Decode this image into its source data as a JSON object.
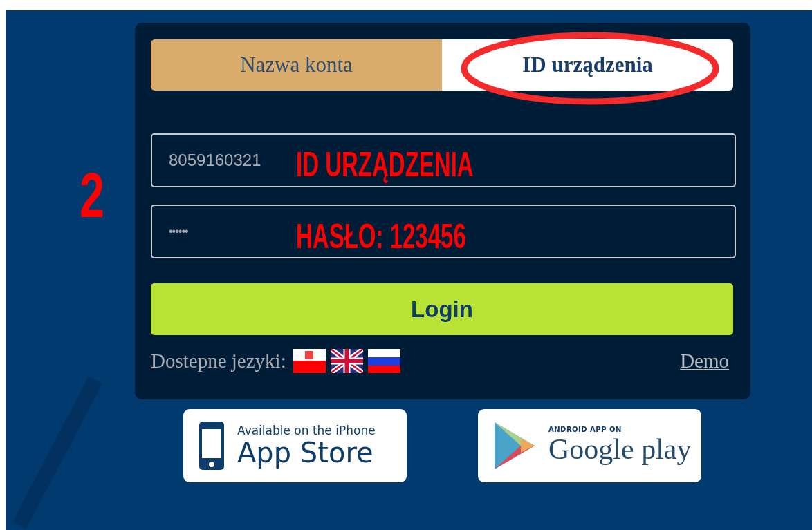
{
  "annotations": {
    "step": "2",
    "device_id_note": "ID URZĄDZENIA",
    "password_note": "HASŁO: 123456"
  },
  "tabs": [
    {
      "label": "Nazwa konta",
      "selected": false,
      "circled": false
    },
    {
      "label": "ID urządzenia",
      "selected": true,
      "circled": true
    }
  ],
  "fields": [
    {
      "kind": "text",
      "value": "8059160321"
    },
    {
      "kind": "password",
      "value": "••••••"
    }
  ],
  "login_button": "Login",
  "footer": {
    "languages_label": "Dostepne jezyki:",
    "languages": [
      {
        "kind": "pl"
      },
      {
        "kind": "gb"
      },
      {
        "kind": "ru"
      }
    ],
    "demo_link": "Demo"
  },
  "badges": [
    {
      "kind": "appstore",
      "small": "Available on the iPhone",
      "large": "App Store"
    },
    {
      "kind": "googleplay",
      "small": "ANDROID APP ON",
      "large": "Google play"
    }
  ]
}
